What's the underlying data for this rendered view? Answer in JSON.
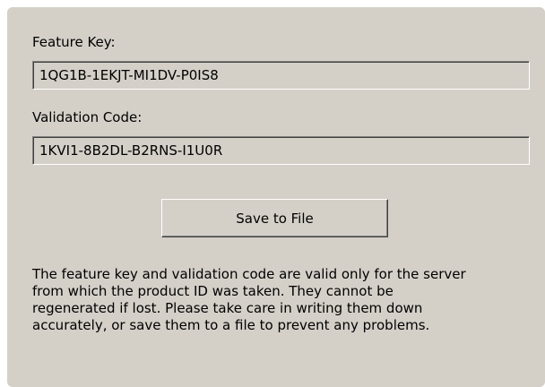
{
  "feature_key": {
    "label": "Feature Key:",
    "value": "1QG1B-1EKJT-MI1DV-P0IS8"
  },
  "validation_code": {
    "label": "Validation Code:",
    "value": "1KVI1-8B2DL-B2RNS-I1U0R"
  },
  "save_button_label": "Save to File",
  "note": "The feature key and validation code are valid only for the server\nfrom which the product ID was taken. They cannot be\nregenerated if lost. Please take care in writing them down\naccurately, or save them to a file to prevent any problems."
}
